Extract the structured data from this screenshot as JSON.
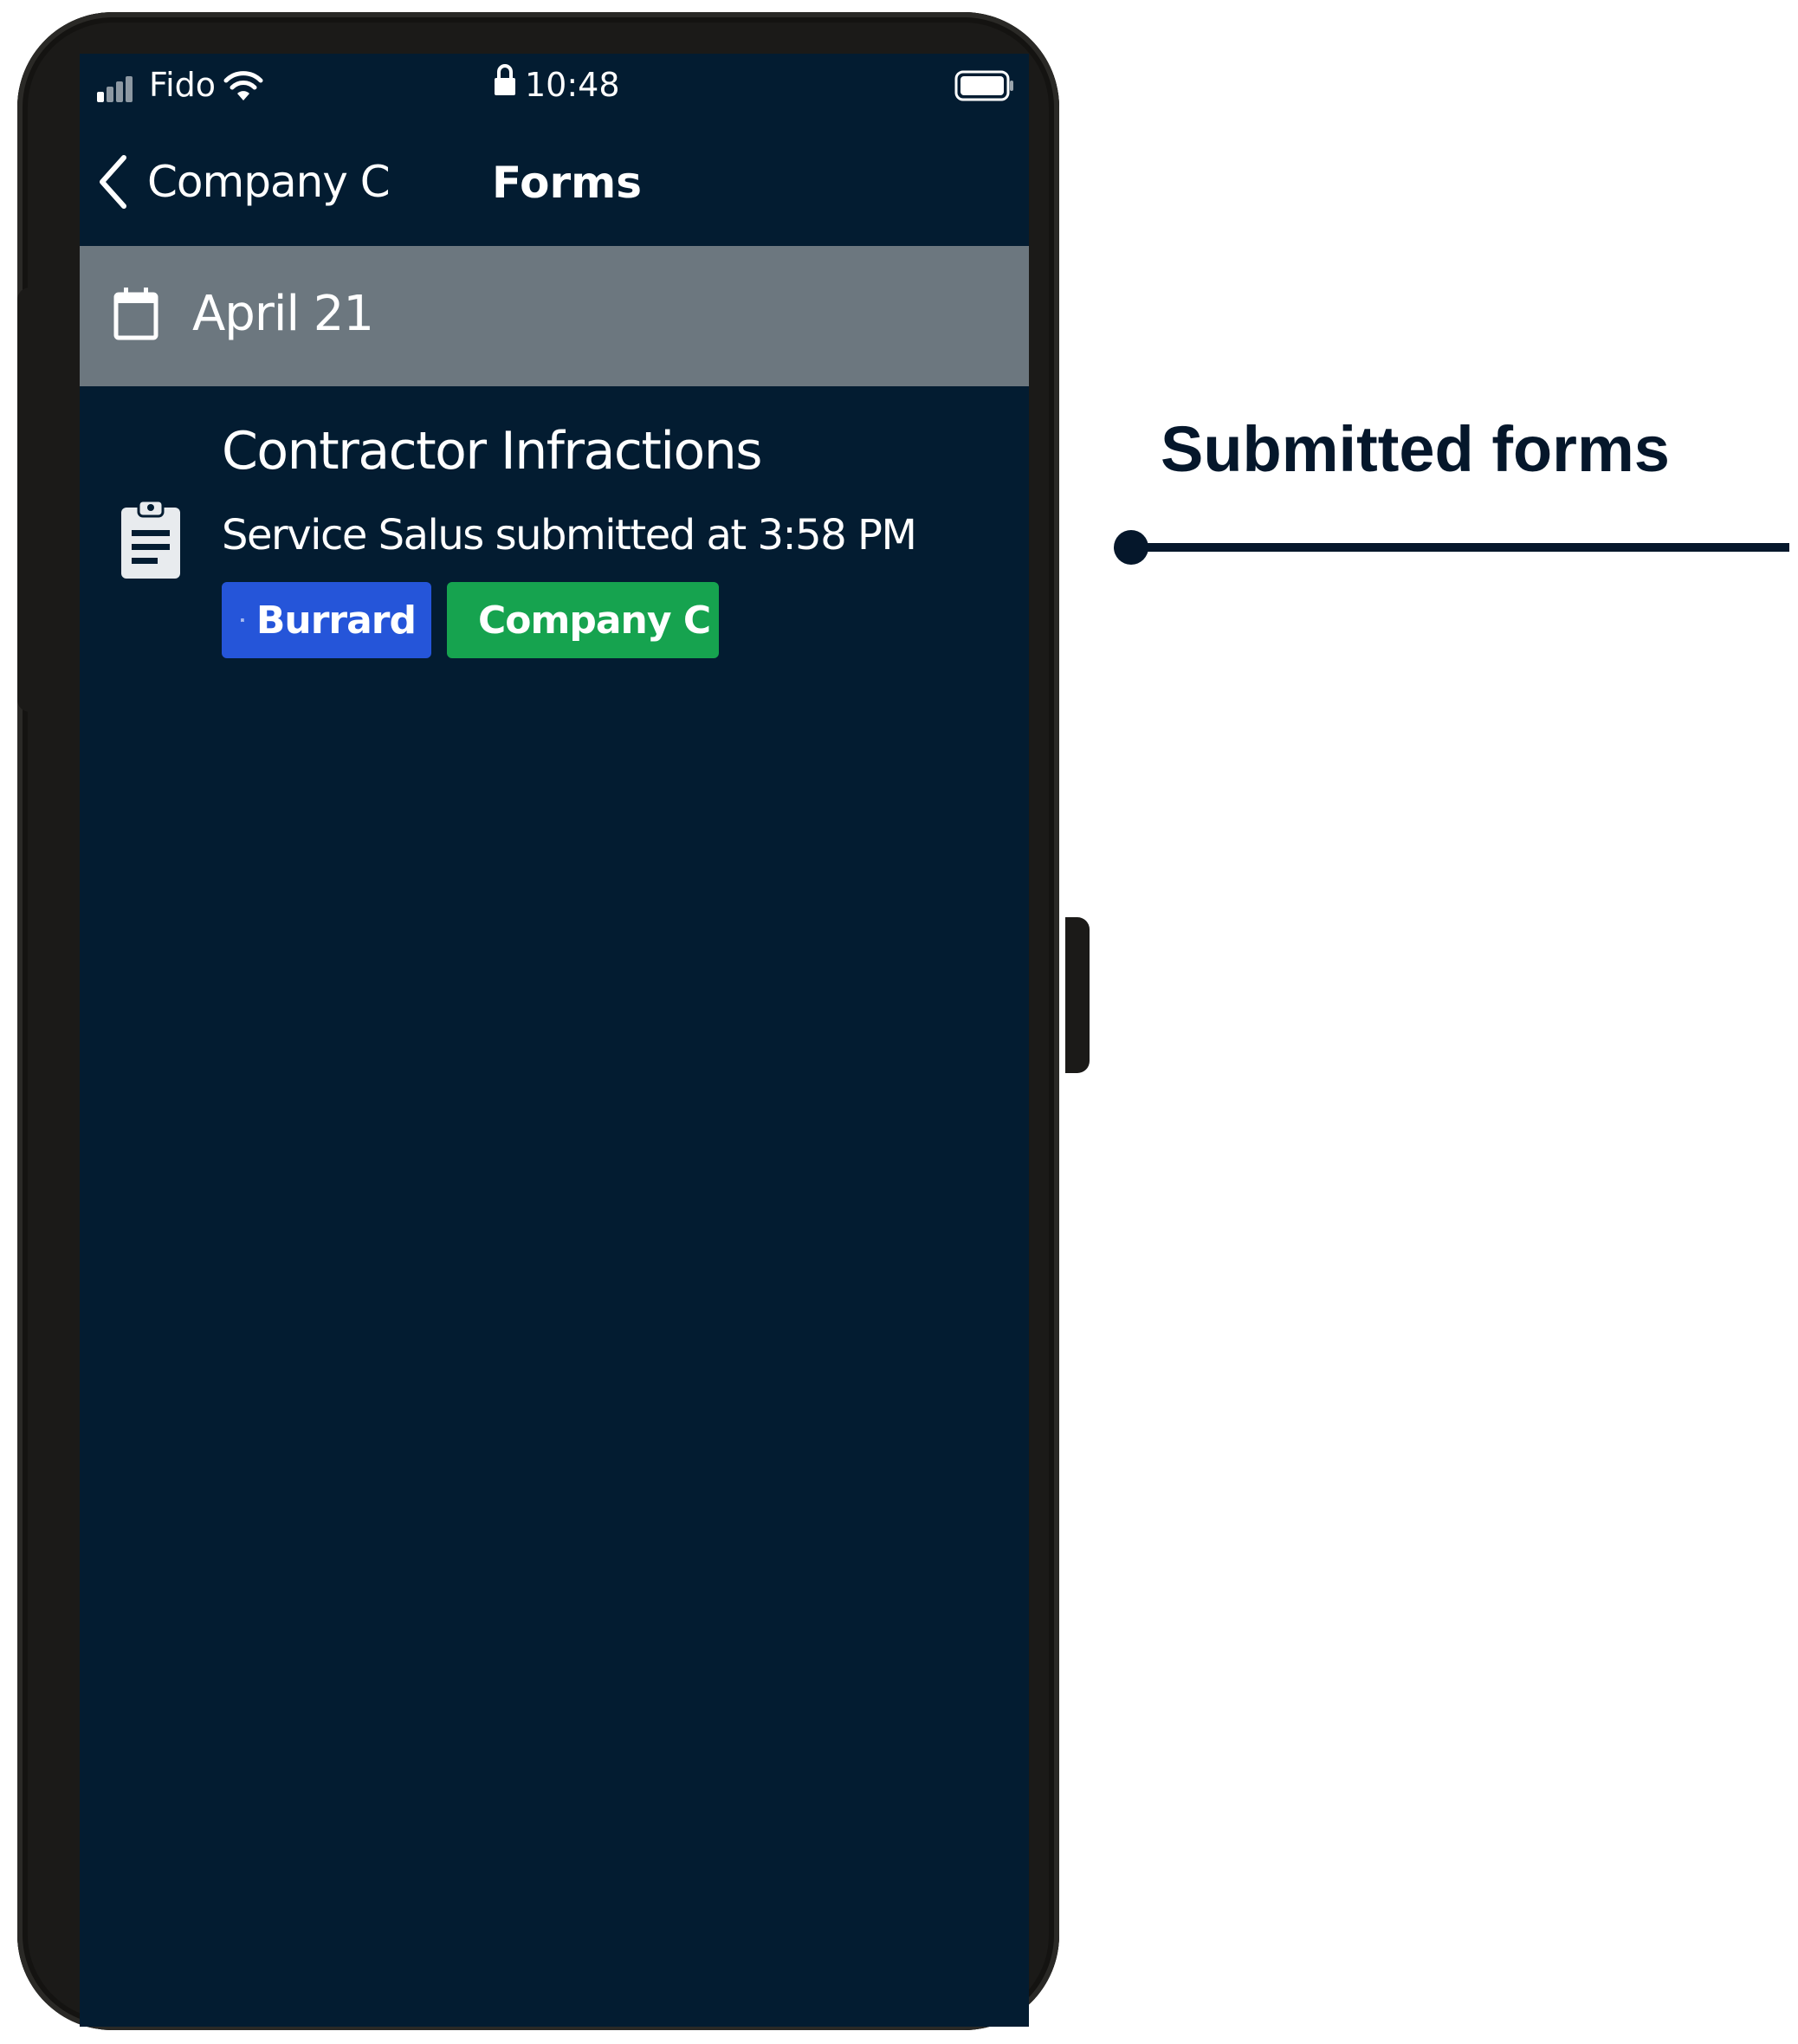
{
  "status_bar": {
    "carrier": "Fido",
    "time": "10:48",
    "icons": [
      "signal-icon",
      "wifi-icon",
      "lock-icon",
      "battery-icon"
    ]
  },
  "nav": {
    "back_label": "Company C",
    "title": "Forms"
  },
  "date_section": {
    "label": "April 21",
    "icon": "calendar-icon"
  },
  "forms": [
    {
      "title": "Contractor Infractions",
      "subtitle": "Service Salus submitted at 3:58 PM",
      "icon": "clipboard-icon",
      "tags": [
        {
          "label": "Burrard",
          "icon": "building-icon",
          "color": "#2555d9"
        },
        {
          "label": "Company C",
          "icon": "truck-icon",
          "color": "#16a34f"
        }
      ]
    }
  ],
  "annotation": {
    "label": "Submitted forms",
    "color": "#05172b"
  },
  "colors": {
    "screen_background": "#031c31",
    "date_header_background": "#6c777f",
    "phone_frame": "#1b1a18"
  }
}
